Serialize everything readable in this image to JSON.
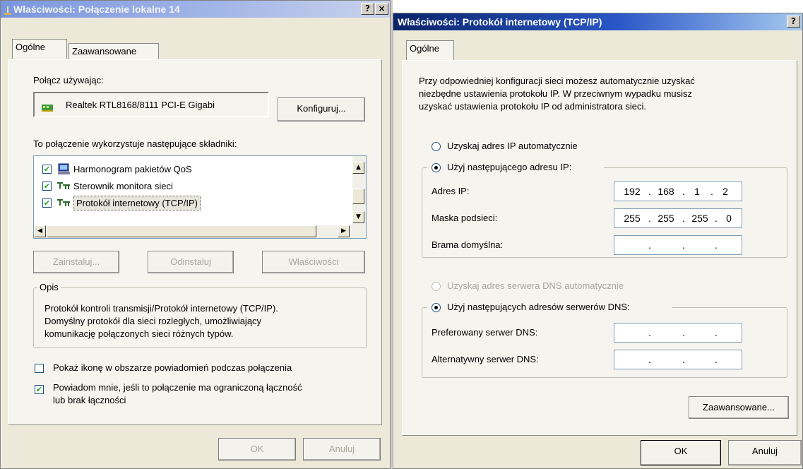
{
  "left_dialog": {
    "title": "Właściwości: Połączenie lokalne 14",
    "help_icon": "?",
    "close_icon": "×",
    "tabs": [
      "Ogólne",
      "Zaawansowane"
    ],
    "connect_using_label": "Połącz używając:",
    "adapter_name": "Realtek RTL8168/8111 PCI-E Gigabi",
    "configure_button": "Konfiguruj...",
    "components_label": "To połączenie wykorzystuje następujące składniki:",
    "components": [
      {
        "label": "Harmonogram pakietów QoS",
        "checked": true,
        "icon": "scheduler-icon"
      },
      {
        "label": "Sterownik monitora sieci",
        "checked": true,
        "icon": "network-protocol-icon"
      },
      {
        "label": "Protokół internetowy (TCP/IP)",
        "checked": true,
        "icon": "network-protocol-icon"
      }
    ],
    "install_button": "Zainstaluj...",
    "uninstall_button": "Odinstaluj",
    "properties_button": "Właściwości",
    "description_legend": "Opis",
    "description_text_1": "Protokół kontroli transmisji/Protokół internetowy (TCP/IP).",
    "description_text_2": "Domyślny protokół dla sieci rozległych, umożliwiający",
    "description_text_3": "komunikację połączonych sieci różnych typów.",
    "show_icon_label": "Pokaż ikonę w obszarze powiadomień podczas połączenia",
    "show_icon_checked": false,
    "notify_label_1": "Powiadom mnie, jeśli to połączenie ma ograniczoną łączność",
    "notify_label_2": "lub brak łączności",
    "notify_checked": true,
    "ok_button": "OK",
    "cancel_button": "Anuluj"
  },
  "right_dialog": {
    "title": "Właściwości: Protokół internetowy (TCP/IP)",
    "help_icon": "?",
    "close_icon": "×",
    "tabs": [
      "Ogólne"
    ],
    "intro_line_1": "Przy odpowiedniej konfiguracji sieci możesz automatycznie uzyskać",
    "intro_line_2": "niezbędne ustawienia protokołu IP. W przeciwnym wypadku musisz",
    "intro_line_3": "uzyskać ustawienia protokołu IP od administratora sieci.",
    "auto_ip_label": "Uzyskaj adres IP automatycznie",
    "use_ip_label": "Użyj następującego adresu IP:",
    "ip_address_label": "Adres IP:",
    "ip_address": [
      "192",
      "168",
      "1",
      "2"
    ],
    "subnet_label": "Maska podsieci:",
    "subnet_mask": [
      "255",
      "255",
      "255",
      "0"
    ],
    "gateway_label": "Brama domyślna:",
    "gateway": [
      "",
      "",
      "",
      ""
    ],
    "auto_dns_label": "Uzyskaj adres serwera DNS automatycznie",
    "use_dns_label": "Użyj następujących adresów serwerów DNS:",
    "preferred_dns_label": "Preferowany serwer DNS:",
    "preferred_dns": [
      "",
      "",
      "",
      ""
    ],
    "alternate_dns_label": "Alternatywny serwer DNS:",
    "alternate_dns": [
      "",
      "",
      "",
      ""
    ],
    "advanced_button": "Zaawansowane...",
    "ok_button": "OK",
    "cancel_button": "Anuluj"
  },
  "colors": {
    "dialog_bg": "#ece9d8",
    "panel_bg": "#f5f4ef",
    "title_active": "#0a246a",
    "title_inactive": "#7a96df",
    "field_border": "#7f9db9",
    "disabled_text": "#a8a69c"
  }
}
